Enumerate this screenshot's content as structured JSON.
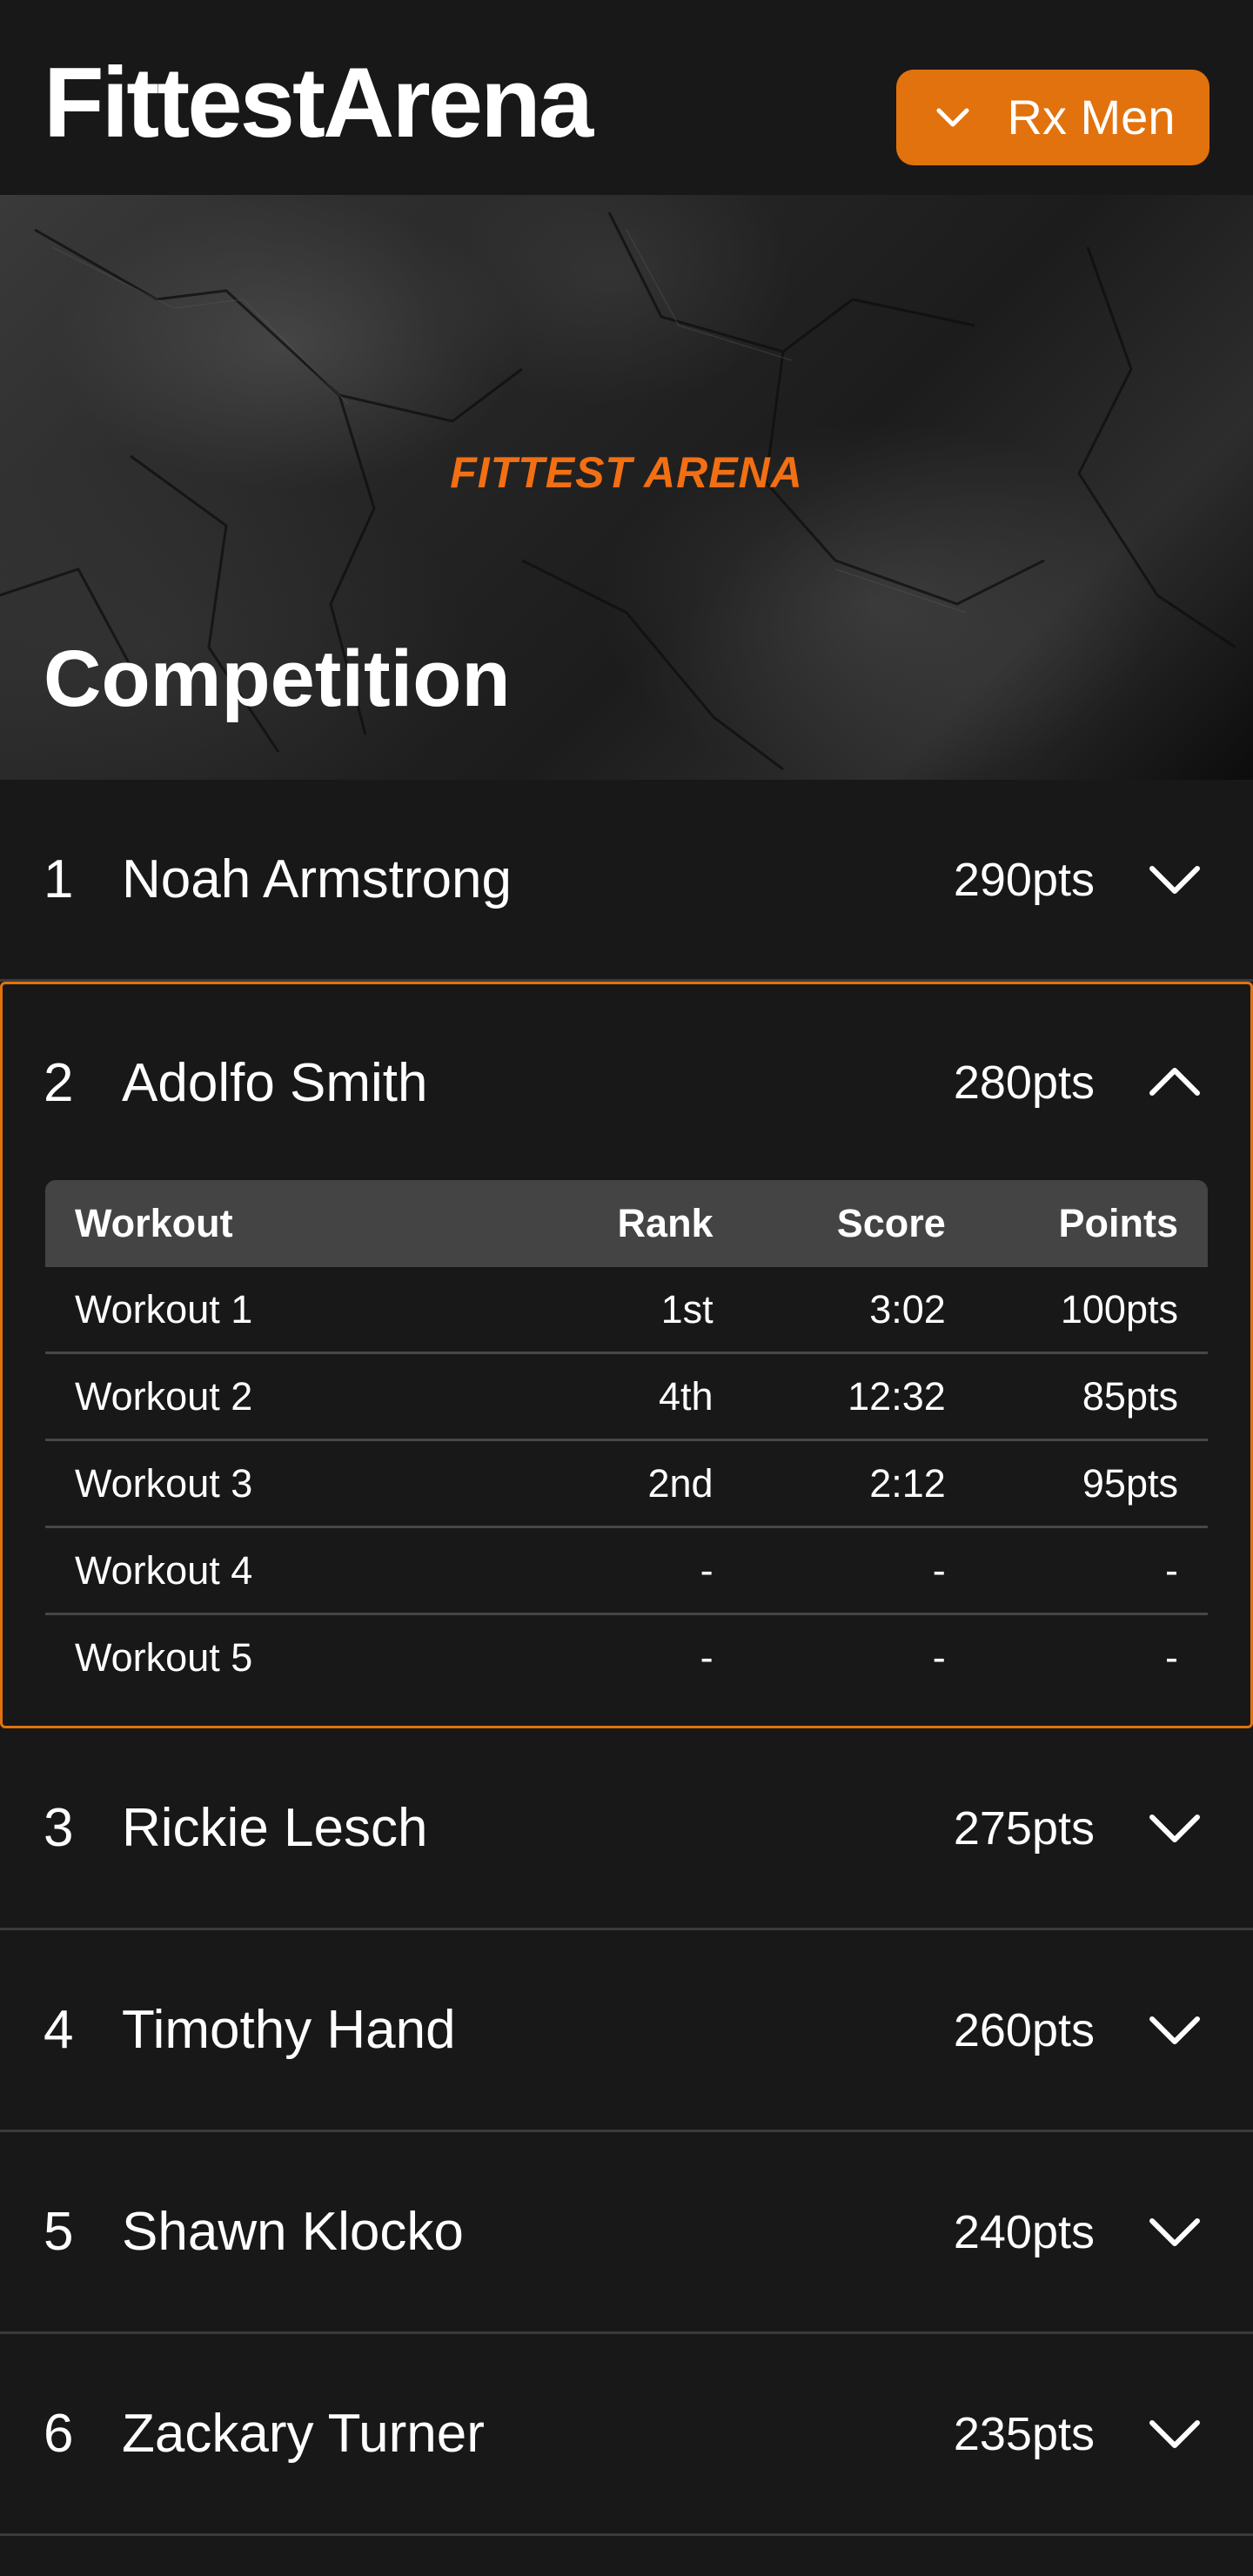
{
  "app": {
    "brand": "FittestArena",
    "division": {
      "label": "Rx Men",
      "icon": "chevron-down-icon"
    }
  },
  "hero": {
    "logo_text": "FITTEST ARENA",
    "title": "Competition"
  },
  "colors": {
    "accent": "#e2720d",
    "background": "#181818",
    "divider": "#3b3b3b",
    "table_header": "#444444"
  },
  "leaderboard": {
    "rows": [
      {
        "rank": "1",
        "name": "Noah Armstrong",
        "points": "290pts",
        "expanded": false
      },
      {
        "rank": "2",
        "name": "Adolfo Smith",
        "points": "280pts",
        "expanded": true
      },
      {
        "rank": "3",
        "name": "Rickie Lesch",
        "points": "275pts",
        "expanded": false
      },
      {
        "rank": "4",
        "name": "Timothy Hand",
        "points": "260pts",
        "expanded": false
      },
      {
        "rank": "5",
        "name": "Shawn Klocko",
        "points": "240pts",
        "expanded": false
      },
      {
        "rank": "6",
        "name": "Zackary Turner",
        "points": "235pts",
        "expanded": false
      }
    ],
    "detail": {
      "columns": [
        "Workout",
        "Rank",
        "Score",
        "Points"
      ],
      "rows": [
        [
          "Workout 1",
          "1st",
          "3:02",
          "100pts"
        ],
        [
          "Workout 2",
          "4th",
          "12:32",
          "85pts"
        ],
        [
          "Workout 3",
          "2nd",
          "2:12",
          "95pts"
        ],
        [
          "Workout 4",
          "-",
          "-",
          "-"
        ],
        [
          "Workout 5",
          "-",
          "-",
          "-"
        ]
      ]
    }
  }
}
